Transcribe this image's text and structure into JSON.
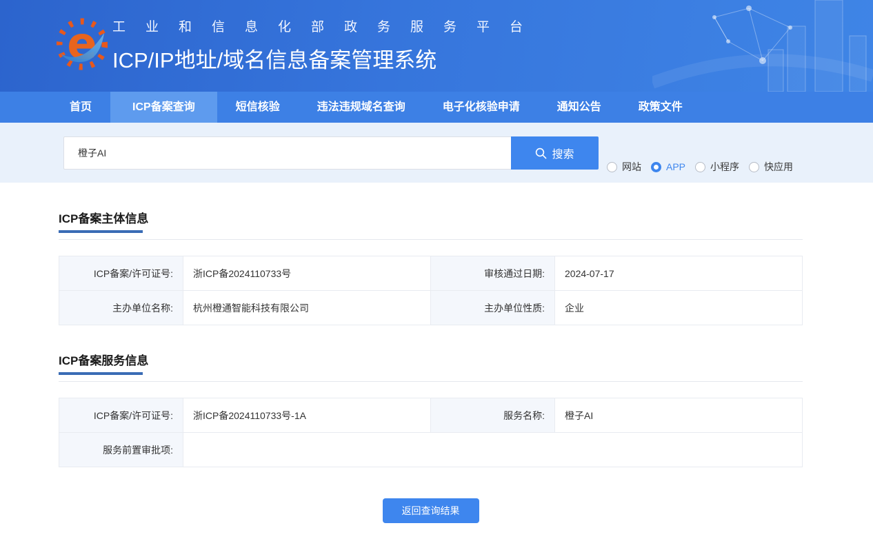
{
  "colors": {
    "accent": "#3e86ee",
    "nav_bg": "#3d80e5",
    "nav_active_bg": "#5e9bee",
    "header_grad_start": "#2c64cd",
    "header_grad_end": "#3f85e6",
    "search_section_bg": "#e9f1fb",
    "table_label_bg": "#f4f7fc",
    "table_border": "#e8ebf1",
    "title_underline": "#3a6cb5",
    "logo_orange": "#e8641e",
    "logo_blue": "#2f7ed0"
  },
  "header": {
    "subtitle": "工业和信息化部政务服务平台",
    "title": "ICP/IP地址/域名信息备案管理系统"
  },
  "nav": {
    "items": [
      {
        "label": "首页",
        "active": false
      },
      {
        "label": "ICP备案查询",
        "active": true
      },
      {
        "label": "短信核验",
        "active": false
      },
      {
        "label": "违法违规域名查询",
        "active": false
      },
      {
        "label": "电子化核验申请",
        "active": false
      },
      {
        "label": "通知公告",
        "active": false
      },
      {
        "label": "政策文件",
        "active": false
      }
    ]
  },
  "search": {
    "value": "橙子AI",
    "button_label": "搜索",
    "options": [
      {
        "label": "网站",
        "selected": false
      },
      {
        "label": "APP",
        "selected": true
      },
      {
        "label": "小程序",
        "selected": false
      },
      {
        "label": "快应用",
        "selected": false
      }
    ]
  },
  "section1": {
    "title": "ICP备案主体信息",
    "row1": {
      "label1": "ICP备案/许可证号:",
      "value1": "浙ICP备2024110733号",
      "label2": "审核通过日期:",
      "value2": "2024-07-17"
    },
    "row2": {
      "label1": "主办单位名称:",
      "value1": "杭州橙通智能科技有限公司",
      "label2": "主办单位性质:",
      "value2": "企业"
    }
  },
  "section2": {
    "title": "ICP备案服务信息",
    "row1": {
      "label1": "ICP备案/许可证号:",
      "value1": "浙ICP备2024110733号-1A",
      "label2": "服务名称:",
      "value2": "橙子AI"
    },
    "row2": {
      "label1": "服务前置审批项:",
      "value1": ""
    }
  },
  "footer": {
    "back_button": "返回查询结果"
  }
}
